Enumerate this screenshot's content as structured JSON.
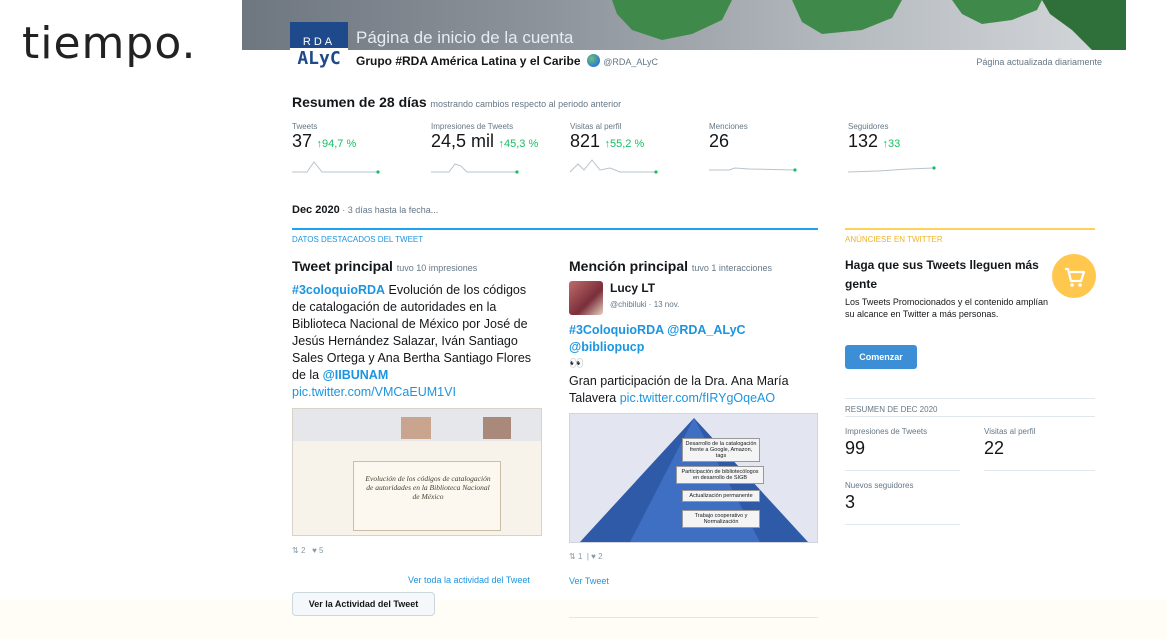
{
  "slide": {
    "heading_fragment": "tiempo."
  },
  "banner": {
    "title": "Página de inicio de la cuenta",
    "logo_top": "RDA",
    "logo_bottom": "ALyC"
  },
  "account": {
    "name": "Grupo #RDA América Latina y el Caribe",
    "handle": "@RDA_ALyC",
    "updated_note": "Página actualizada diariamente"
  },
  "summary": {
    "title": "Resumen de 28 días",
    "subtitle": "mostrando cambios respecto al periodo anterior",
    "metrics": [
      {
        "label": "Tweets",
        "value": "37",
        "change": "↑94,7 %"
      },
      {
        "label": "Impresiones de Tweets",
        "value": "24,5 mil",
        "change": "↑45,3 %"
      },
      {
        "label": "Visitas al perfil",
        "value": "821",
        "change": "↑55,2 %"
      },
      {
        "label": "Menciones",
        "value": "26",
        "change": ""
      },
      {
        "label": "Seguidores",
        "value": "132",
        "change": "↑33"
      }
    ]
  },
  "period": {
    "month": "Dec 2020",
    "note": " · 3 días hasta la fecha..."
  },
  "highlights": {
    "section_label": "DATOS DESTACADOS DEL TWEET",
    "top_tweet": {
      "title": "Tweet principal",
      "subtitle": "tuvo 10 impresiones",
      "hashtag": "#3coloquioRDA",
      "text_1": " Evolución de los códigos de catalogación de autoridades en la Biblioteca Nacional de México por José de Jesús Hernández Salazar, Iván Santiago Sales Ortega y Ana Bertha Santiago Flores de la ",
      "mention": "@IIBUNAM",
      "link": "pic.twitter.com/VMCaEUM1VI",
      "image_text": "Evolución de los códigos de catalogación de autoridades en la Biblioteca Nacional de México",
      "retweets": "2",
      "likes": "5",
      "activity_link": "Ver toda la actividad del Tweet",
      "activity_button": "Ver la Actividad del Tweet"
    },
    "top_mention": {
      "title": "Mención principal",
      "subtitle": "tuvo 1 interacciones",
      "name": "Lucy LT",
      "handle": "@chibiluki · 13 nov.",
      "tags": "#3ColoquioRDA @RDA_ALyC @bibliopucp",
      "emoji": "👀",
      "body": "Gran participación de la Dra. Ana María Talavera ",
      "link": "pic.twitter.com/fIRYgOqeAO",
      "image_boxes": [
        "Desarrollo de la catalogación frente a Google, Amazon, tags",
        "Participación de bibliotecólogos en desarrollo de SIGB",
        "Actualización permanente",
        "Trabajo cooperativo y Normalización"
      ],
      "retweets": "1",
      "likes": "2",
      "view_link": "Ver Tweet"
    }
  },
  "promo": {
    "section_label": "ANÚNCIESE EN TWITTER",
    "title": "Haga que sus Tweets lleguen más gente",
    "text": "Los Tweets Promocionados y el contenido amplían su alcance en Twitter a más personas.",
    "button": "Comenzar"
  },
  "month_summary": {
    "heading": "RESUMEN DE DEC 2020",
    "impressions_label": "Impresiones de Tweets",
    "impressions_value": "99",
    "visits_label": "Visitas al perfil",
    "visits_value": "22",
    "followers_label": "Nuevos seguidores",
    "followers_value": "3"
  },
  "colors": {
    "link": "#1b95e0",
    "positive": "#17bf63",
    "accent_blue": "#1da1f2",
    "accent_gold": "#ffd05a"
  }
}
